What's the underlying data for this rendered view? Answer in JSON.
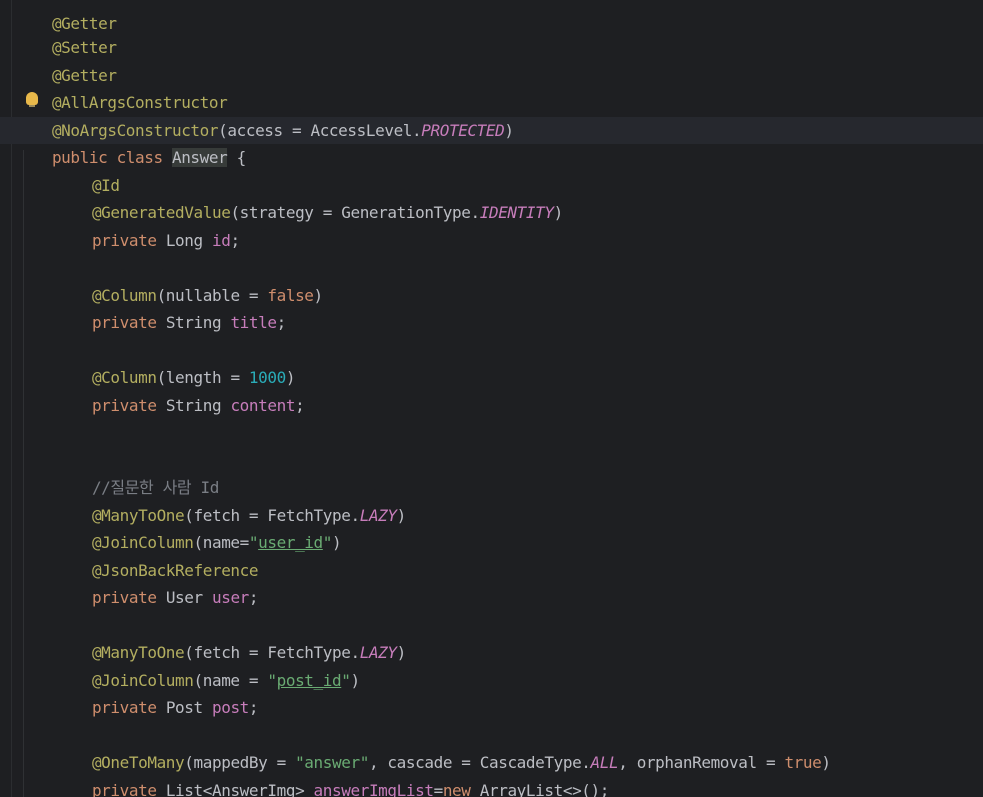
{
  "code": {
    "line0": {
      "ann": "@Getter"
    },
    "line1": {
      "ann": "@Setter"
    },
    "line2": {
      "ann": "@Getter"
    },
    "line3": {
      "ann": "@AllArgsConstructor"
    },
    "line4": {
      "ann": "@NoArgsConstructor",
      "pre": "(access = AccessLevel.",
      "const": "PROTECTED",
      "post": ")"
    },
    "line5": {
      "kw": "public class ",
      "cls": "Answer",
      "post": " {"
    },
    "line6": {
      "ann": "@Id"
    },
    "line7": {
      "ann": "@GeneratedValue",
      "pre": "(strategy = GenerationType.",
      "const": "IDENTITY",
      "post": ")"
    },
    "line8": {
      "kw": "private ",
      "type": "Long ",
      "field": "id",
      "post": ";"
    },
    "line9": {
      "ann": "@Column",
      "pre": "(nullable = ",
      "kw": "false",
      "post": ")"
    },
    "line10": {
      "kw": "private ",
      "type": "String ",
      "field": "title",
      "post": ";"
    },
    "line11": {
      "ann": "@Column",
      "pre": "(length = ",
      "num": "1000",
      "post": ")"
    },
    "line12": {
      "kw": "private ",
      "type": "String ",
      "field": "content",
      "post": ";"
    },
    "line13": {
      "comment": "//질문한 사람 Id"
    },
    "line14": {
      "ann": "@ManyToOne",
      "pre": "(fetch = FetchType.",
      "const": "LAZY",
      "post": ")"
    },
    "line15": {
      "ann": "@JoinColumn",
      "pre": "(name=",
      "q1": "\"",
      "str": "user_id",
      "q2": "\"",
      "post": ")"
    },
    "line16": {
      "ann": "@JsonBackReference"
    },
    "line17": {
      "kw": "private ",
      "type": "User ",
      "field": "user",
      "post": ";"
    },
    "line18": {
      "ann": "@ManyToOne",
      "pre": "(fetch = FetchType.",
      "const": "LAZY",
      "post": ")"
    },
    "line19": {
      "ann": "@JoinColumn",
      "pre": "(name = ",
      "q1": "\"",
      "str": "post_id",
      "q2": "\"",
      "post": ")"
    },
    "line20": {
      "kw": "private ",
      "type": "Post ",
      "field": "post",
      "post": ";"
    },
    "line21": {
      "ann": "@OneToMany",
      "pre": "(mappedBy = ",
      "str": "\"answer\"",
      "mid": ", cascade = CascadeType.",
      "const": "ALL",
      "mid2": ", orphanRemoval = ",
      "kw": "true",
      "post": ")"
    },
    "line22": {
      "kw": "private ",
      "type": "List<AnswerImg> ",
      "field": "answerImgList",
      "eq": "=",
      "kw2": "new ",
      "post": "ArrayList<>();"
    }
  },
  "colors": {
    "background": "#1e1f22",
    "current_line": "#26282e",
    "annotation": "#b3ae60",
    "keyword": "#cf8e6d",
    "field": "#c77dbb",
    "number": "#2aacb8",
    "string": "#6aab73",
    "comment": "#7a7e85",
    "text": "#bcbec4"
  },
  "icons": {
    "intention_bulb": "lightbulb-icon"
  }
}
